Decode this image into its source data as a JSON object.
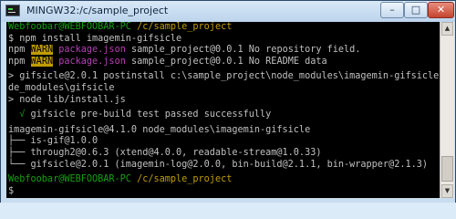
{
  "window": {
    "title": "MINGW32:/c/sample_project",
    "minimize_label": "–",
    "maximize_label": "□",
    "close_label": "✕"
  },
  "console": {
    "prompt1": {
      "userhost": "Webfoobar@WEBFOOBAR-PC",
      "path": "/c/sample_project"
    },
    "cmd1": "$ npm install imagemin-gifsicle",
    "warn1": {
      "prefix": "npm ",
      "tag": "WARN",
      "pkg": "package.json",
      "msg": " sample_project@0.0.1 No repository field."
    },
    "warn2": {
      "prefix": "npm ",
      "tag": "WARN",
      "pkg": "package.json",
      "msg": " sample_project@0.0.1 No README data"
    },
    "postinstall1": "> gifsicle@2.0.1 postinstall c:\\sample_project\\node_modules\\imagemin-gifsicle\\no",
    "postinstall2": "de_modules\\gifsicle",
    "postinstall3": "> node lib/install.js",
    "pass_check": "√",
    "pass_text": " gifsicle pre-build test passed successfully",
    "tree": [
      "imagemin-gifsicle@4.1.0 node_modules\\imagemin-gifsicle",
      "├── is-gif@1.0.0",
      "├── through2@0.6.3 (xtend@4.0.0, readable-stream@1.0.33)",
      "└── gifsicle@2.0.1 (imagemin-log@2.0.0, bin-build@2.1.1, bin-wrapper@2.1.3)"
    ],
    "prompt2": {
      "userhost": "Webfoobar@WEBFOOBAR-PC",
      "path": "/c/sample_project"
    },
    "cmd2": "$ "
  },
  "scrollbar": {
    "up_label": "▲",
    "down_label": "▼"
  }
}
